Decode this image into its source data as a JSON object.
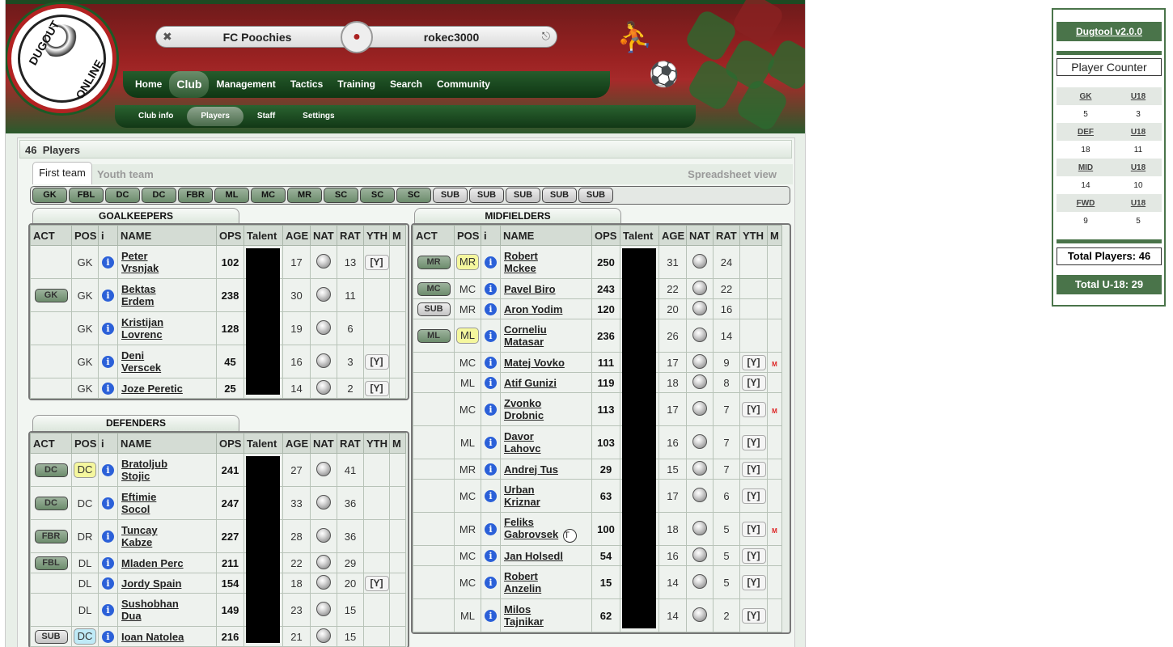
{
  "header": {
    "club": "FC Poochies",
    "user": "rokec3000",
    "logo_text": "DUGOUT ONLINE"
  },
  "nav": [
    "Home",
    "Club",
    "Management",
    "Tactics",
    "Training",
    "Search",
    "Community"
  ],
  "subnav": [
    "Club info",
    "Players",
    "Staff",
    "Settings"
  ],
  "count": {
    "num": "46",
    "label": "Players"
  },
  "tabs": {
    "first": "First team",
    "youth": "Youth team",
    "sheet": "Spreadsheet view"
  },
  "posbar": [
    {
      "label": "GK",
      "kind": "green"
    },
    {
      "label": "FBL",
      "kind": "green"
    },
    {
      "label": "DC",
      "kind": "green"
    },
    {
      "label": "DC",
      "kind": "green"
    },
    {
      "label": "FBR",
      "kind": "green"
    },
    {
      "label": "ML",
      "kind": "green"
    },
    {
      "label": "MC",
      "kind": "green"
    },
    {
      "label": "MR",
      "kind": "green"
    },
    {
      "label": "SC",
      "kind": "green"
    },
    {
      "label": "SC",
      "kind": "green"
    },
    {
      "label": "SC",
      "kind": "green"
    },
    {
      "label": "SUB",
      "kind": "grey"
    },
    {
      "label": "SUB",
      "kind": "grey"
    },
    {
      "label": "SUB",
      "kind": "grey"
    },
    {
      "label": "SUB",
      "kind": "grey"
    },
    {
      "label": "SUB",
      "kind": "grey"
    }
  ],
  "columns": [
    "ACT",
    "POS",
    "i",
    "NAME",
    "OPS",
    "Talent",
    "AGE",
    "NAT",
    "RAT",
    "YTH",
    "M"
  ],
  "sections": {
    "gk": {
      "title": "GOALKEEPERS",
      "rows": [
        {
          "act": "",
          "pos": "GK",
          "pb": "",
          "name": [
            "Peter",
            "Vrsnjak"
          ],
          "ops": "102",
          "age": "17",
          "rat": "13",
          "yth": "[Y]",
          "m": ""
        },
        {
          "act": "GK",
          "ak": "green",
          "pos": "GK",
          "pb": "",
          "name": [
            "Bektas",
            "Erdem"
          ],
          "ops": "238",
          "age": "30",
          "rat": "11",
          "yth": "",
          "m": ""
        },
        {
          "act": "",
          "pos": "GK",
          "pb": "",
          "name": [
            "Kristijan",
            "Lovrenc"
          ],
          "ops": "128",
          "age": "19",
          "rat": "6",
          "yth": "",
          "m": ""
        },
        {
          "act": "",
          "pos": "GK",
          "pb": "",
          "name": [
            "Deni",
            "Verscek"
          ],
          "ops": "45",
          "age": "16",
          "rat": "3",
          "yth": "[Y]",
          "m": ""
        },
        {
          "act": "",
          "pos": "GK",
          "pb": "",
          "name": [
            "Joze Peretic"
          ],
          "ops": "25",
          "age": "14",
          "rat": "2",
          "yth": "[Y]",
          "m": ""
        }
      ]
    },
    "def": {
      "title": "DEFENDERS",
      "rows": [
        {
          "act": "DC",
          "ak": "green",
          "pos": "DC",
          "pb": "yellow",
          "name": [
            "Bratoljub",
            "Stojic"
          ],
          "ops": "241",
          "age": "27",
          "rat": "41",
          "yth": "",
          "m": ""
        },
        {
          "act": "DC",
          "ak": "green",
          "pos": "DC",
          "pb": "",
          "name": [
            "Eftimie",
            "Socol"
          ],
          "ops": "247",
          "age": "33",
          "rat": "36",
          "yth": "",
          "m": ""
        },
        {
          "act": "FBR",
          "ak": "green",
          "pos": "DR",
          "pb": "",
          "name": [
            "Tuncay",
            "Kabze"
          ],
          "ops": "227",
          "age": "28",
          "rat": "36",
          "yth": "",
          "m": ""
        },
        {
          "act": "FBL",
          "ak": "green",
          "pos": "DL",
          "pb": "",
          "name": [
            "Mladen Perc"
          ],
          "ops": "211",
          "age": "22",
          "rat": "29",
          "yth": "",
          "m": ""
        },
        {
          "act": "",
          "pos": "DL",
          "pb": "",
          "name": [
            "Jordy Spain"
          ],
          "ops": "154",
          "age": "18",
          "rat": "20",
          "yth": "[Y]",
          "m": ""
        },
        {
          "act": "",
          "pos": "DL",
          "pb": "",
          "name": [
            "Sushobhan",
            "Dua"
          ],
          "ops": "149",
          "age": "23",
          "rat": "15",
          "yth": "",
          "m": ""
        },
        {
          "act": "SUB",
          "ak": "grey",
          "pos": "DC",
          "pb": "blue",
          "name": [
            "Ioan Natolea"
          ],
          "ops": "216",
          "age": "21",
          "rat": "15",
          "yth": "",
          "m": ""
        }
      ]
    },
    "mid": {
      "title": "MIDFIELDERS",
      "rows": [
        {
          "act": "MR",
          "ak": "green",
          "pos": "MR",
          "pb": "yellow",
          "name": [
            "Robert",
            "Mckee"
          ],
          "ops": "250",
          "age": "31",
          "rat": "24",
          "yth": "",
          "m": ""
        },
        {
          "act": "MC",
          "ak": "green",
          "pos": "MC",
          "pb": "",
          "name": [
            "Pavel Biro"
          ],
          "ops": "243",
          "age": "22",
          "rat": "22",
          "yth": "",
          "m": ""
        },
        {
          "act": "SUB",
          "ak": "grey",
          "pos": "MR",
          "pb": "",
          "name": [
            "Aron Yodim"
          ],
          "ops": "120",
          "age": "20",
          "rat": "16",
          "yth": "",
          "m": ""
        },
        {
          "act": "ML",
          "ak": "green",
          "pos": "ML",
          "pb": "yellow",
          "name": [
            "Corneliu",
            "Matasar"
          ],
          "ops": "236",
          "age": "26",
          "rat": "14",
          "yth": "",
          "m": ""
        },
        {
          "act": "",
          "pos": "MC",
          "pb": "",
          "name": [
            "Matej Vovko"
          ],
          "ops": "111",
          "age": "17",
          "rat": "9",
          "yth": "[Y]",
          "m": "M"
        },
        {
          "act": "",
          "pos": "ML",
          "pb": "",
          "name": [
            "Atif Gunizi"
          ],
          "ops": "119",
          "age": "18",
          "rat": "8",
          "yth": "[Y]",
          "m": ""
        },
        {
          "act": "",
          "pos": "MC",
          "pb": "",
          "name": [
            "Zvonko",
            "Drobnic"
          ],
          "ops": "113",
          "age": "17",
          "rat": "7",
          "yth": "[Y]",
          "m": "M"
        },
        {
          "act": "",
          "pos": "ML",
          "pb": "",
          "name": [
            "Davor",
            "Lahovc"
          ],
          "ops": "103",
          "age": "16",
          "rat": "7",
          "yth": "[Y]",
          "m": ""
        },
        {
          "act": "",
          "pos": "MR",
          "pb": "",
          "name": [
            "Andrej Tus"
          ],
          "ops": "29",
          "age": "15",
          "rat": "7",
          "yth": "[Y]",
          "m": ""
        },
        {
          "act": "",
          "pos": "MC",
          "pb": "",
          "name": [
            "Urban",
            "Kriznar"
          ],
          "ops": "63",
          "age": "17",
          "rat": "6",
          "yth": "[Y]",
          "m": ""
        },
        {
          "act": "",
          "pos": "MR",
          "pb": "",
          "name": [
            "Feliks",
            "Gabrovsek"
          ],
          "ops": "100",
          "age": "18",
          "rat": "5",
          "yth": "[Y]",
          "m": "M",
          "badge": "T"
        },
        {
          "act": "",
          "pos": "MC",
          "pb": "",
          "name": [
            "Jan Holsedl"
          ],
          "ops": "54",
          "age": "16",
          "rat": "5",
          "yth": "[Y]",
          "m": ""
        },
        {
          "act": "",
          "pos": "MC",
          "pb": "",
          "name": [
            "Robert",
            "Anzelin"
          ],
          "ops": "15",
          "age": "14",
          "rat": "5",
          "yth": "[Y]",
          "m": ""
        },
        {
          "act": "",
          "pos": "ML",
          "pb": "",
          "name": [
            "Milos",
            "Tajnikar"
          ],
          "ops": "62",
          "age": "14",
          "rat": "2",
          "yth": "[Y]",
          "m": ""
        }
      ]
    }
  },
  "side": {
    "title": "Dugtool v2.0.0",
    "counter": "Player Counter",
    "groups": [
      {
        "pos": "GK",
        "u": "U18",
        "a": "5",
        "b": "3"
      },
      {
        "pos": "DEF",
        "u": "U18",
        "a": "18",
        "b": "11"
      },
      {
        "pos": "MID",
        "u": "U18",
        "a": "14",
        "b": "10"
      },
      {
        "pos": "FWD",
        "u": "U18",
        "a": "9",
        "b": "5"
      }
    ],
    "total": "Total Players: 46",
    "total_u18": "Total U-18: 29"
  }
}
